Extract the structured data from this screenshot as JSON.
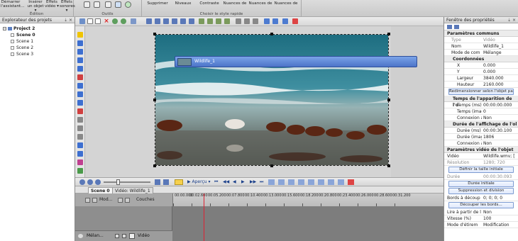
{
  "ribbon": {
    "edition_group": {
      "buttons": [
        "Démarrer l'assistant...",
        "Insérer un objet ▾",
        "Effets vidéo ▾",
        "Effets sonores ▾"
      ],
      "label": "Édition"
    },
    "tools_group": {
      "label": "Outils"
    },
    "style_group": {
      "buttons": [
        "Supprimer",
        "Niveaux",
        "Contraste",
        "Nuances de",
        "Nuances de",
        "Nuances de"
      ],
      "label": "Choisir le style rapide"
    }
  },
  "explorer": {
    "title": "Explorateur des projets",
    "pin": "⇣ ×",
    "project": "Project 2",
    "scenes": [
      "Scene 0",
      "Scene 1",
      "Scene 2",
      "Scene 3"
    ]
  },
  "transport": {
    "preview_label": "▶ Aperçu ▾",
    "controls": [
      "⏮",
      "◀◀",
      "◀",
      "▶",
      "▶▶",
      "⏭"
    ]
  },
  "tabs": [
    "Scene 0",
    "Vidéo: Wildlife_1"
  ],
  "timeline": {
    "ticks": [
      "00:00.000",
      "00:02.600",
      "00:05.200",
      "00:07.800",
      "00:10.400",
      "00:13.000",
      "00:15.600",
      "00:18.200",
      "00:20.800",
      "00:23.400",
      "00:26.000",
      "00:28.600",
      "00:31.200"
    ],
    "header_mode": "Mod...",
    "header_layers": "Couches",
    "track_mode": "Mélan...",
    "track_kind": "Vidéo",
    "clip_name": "Wildlife_1"
  },
  "properties": {
    "title": "Fenêtre des propriétés",
    "pin": "⇣ ×",
    "common_section": "Paramètres communs",
    "common": [
      {
        "k": "Type",
        "v": "Vidéo",
        "grey": true
      },
      {
        "k": "Nom",
        "v": "Wildlife_1"
      },
      {
        "k": "Mode de comp",
        "v": "Mélange"
      }
    ],
    "coords_section": "Coordonnées",
    "coords": [
      {
        "k": "X",
        "v": "0.000"
      },
      {
        "k": "Y",
        "v": "0.000"
      },
      {
        "k": "Largeur",
        "v": "3840.000"
      },
      {
        "k": "Hauteur",
        "v": "2160.000"
      }
    ],
    "resize_button": "Redimensionner selon l'objet parent",
    "appear_section": "Temps de l'apparition de l'o",
    "appear": [
      {
        "k": "Temps (ms)",
        "v": "00:00:00.000"
      },
      {
        "k": "Temps (imag",
        "v": "0"
      },
      {
        "k": "Connexion ar",
        "v": "Non"
      }
    ],
    "duration_section": "Durée de l'affichage de l'ol",
    "duration": [
      {
        "k": "Durée (ms)",
        "v": "00:00:30.100"
      },
      {
        "k": "Durée (image",
        "v": "1806"
      },
      {
        "k": "Connexion ar",
        "v": "Non"
      }
    ],
    "video_section": "Paramètres vidéo de l'objet",
    "video": [
      {
        "k": "Vidéo",
        "v": "Wildlife.wmv; ["
      },
      {
        "k": "Résolution",
        "v": "1280; 720",
        "grey": true
      }
    ],
    "initial_size_button": "Définir la taille initiale",
    "duration_row": {
      "k": "Durée",
      "v": "00:00:30.093",
      "grey": true
    },
    "initial_duration_button": "Durée initiale",
    "split_button": "Suppression et division",
    "borders_row": {
      "k": "Bords à découp",
      "v": "0; 0; 0; 0"
    },
    "crop_button": "Découper les bords...",
    "tail": [
      {
        "k": "Lire à partir de l",
        "v": "Non"
      },
      {
        "k": "Vitesse (%)",
        "v": "100"
      },
      {
        "k": "Mode d'étirem",
        "v": "Modification"
      }
    ]
  }
}
